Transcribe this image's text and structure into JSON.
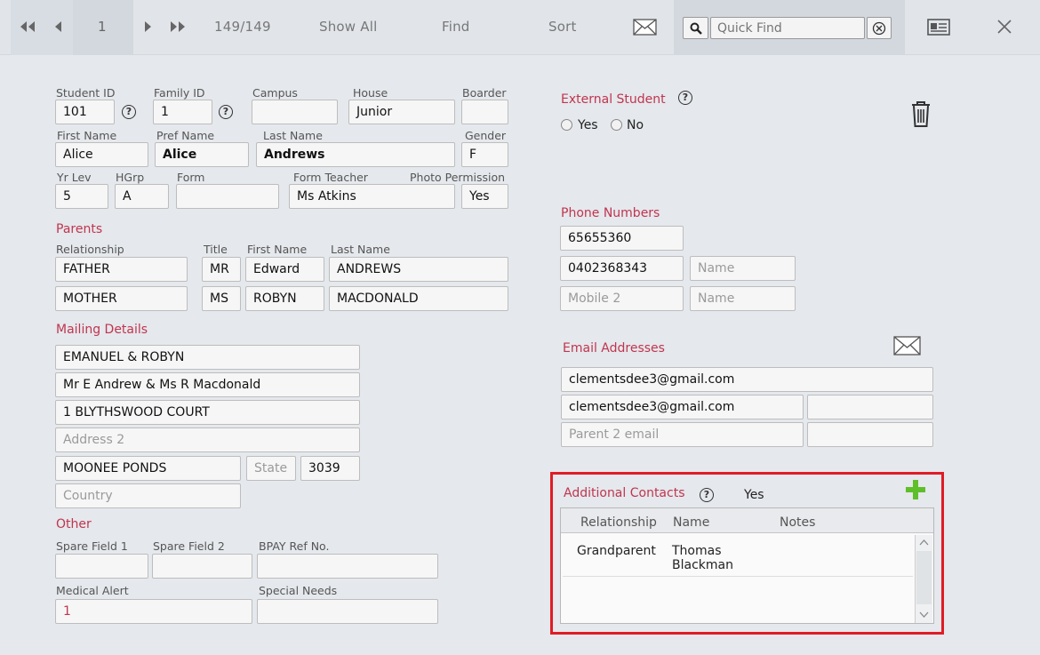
{
  "toolbar": {
    "record_current": "1",
    "record_count": "149/149",
    "show_all": "Show All",
    "find": "Find",
    "sort": "Sort",
    "quick_find_placeholder": "Quick Find"
  },
  "student": {
    "labels": {
      "student_id": "Student ID",
      "family_id": "Family ID",
      "campus": "Campus",
      "house": "House",
      "boarder": "Boarder",
      "first_name": "First Name",
      "pref_name": "Pref Name",
      "last_name": "Last Name",
      "gender": "Gender",
      "yr_lev": "Yr Lev",
      "hgrp": "HGrp",
      "form": "Form",
      "form_teacher": "Form Teacher",
      "photo_permission": "Photo Permission"
    },
    "student_id": "101",
    "family_id": "1",
    "campus": "",
    "house": "Junior",
    "boarder": "",
    "first_name": "Alice",
    "pref_name": "Alice",
    "last_name": "Andrews",
    "gender": "F",
    "yr_lev": "5",
    "hgrp": "A",
    "form": "",
    "form_teacher": "Ms Atkins",
    "photo_permission": "Yes"
  },
  "parents": {
    "title": "Parents",
    "headers": {
      "relationship": "Relationship",
      "title": "Title",
      "first_name": "First Name",
      "last_name": "Last Name"
    },
    "rows": [
      {
        "relationship": "FATHER",
        "title": "MR",
        "first_name": "Edward",
        "last_name": "ANDREWS"
      },
      {
        "relationship": "MOTHER",
        "title": "MS",
        "first_name": "ROBYN",
        "last_name": "MACDONALD"
      }
    ]
  },
  "mailing": {
    "title": "Mailing Details",
    "line1": "EMANUEL & ROBYN",
    "line2": "Mr E Andrew & Ms R Macdonald",
    "line3": "1 BLYTHSWOOD COURT",
    "address2_placeholder": "Address 2",
    "suburb": "MOONEE PONDS",
    "state_placeholder": "State",
    "postcode": "3039",
    "country_placeholder": "Country"
  },
  "other": {
    "title": "Other",
    "spare1_label": "Spare Field 1",
    "spare2_label": "Spare Field 2",
    "bpay_label": "BPAY Ref No.",
    "medical_label": "Medical Alert",
    "special_label": "Special Needs",
    "medical_value": "1"
  },
  "external": {
    "title": "External Student",
    "yes": "Yes",
    "no": "No"
  },
  "phones": {
    "title": "Phone Numbers",
    "phone1": "65655360",
    "phone2": "0402368343",
    "name_placeholder": "Name",
    "mobile2_placeholder": "Mobile 2"
  },
  "email": {
    "title": "Email Addresses",
    "email1": "clementsdee3@gmail.com",
    "email2": "clementsdee3@gmail.com",
    "parent2_placeholder": "Parent 2 email"
  },
  "contacts": {
    "title": "Additional Contacts",
    "flag": "Yes",
    "headers": {
      "relationship": "Relationship",
      "name": "Name",
      "notes": "Notes"
    },
    "rows": [
      {
        "relationship": "Grandparent",
        "name_line1": "Thomas",
        "name_line2": "Blackman",
        "notes": ""
      }
    ]
  },
  "colors": {
    "section": "#c0354f",
    "highlight": "#e01c25",
    "add": "#5fbf2a"
  },
  "icons": [
    "first-record-icon",
    "prev-record-icon",
    "next-record-icon",
    "last-record-icon",
    "envelope-icon",
    "search-icon",
    "clear-icon",
    "card-view-icon",
    "close-icon",
    "trash-icon",
    "help-icon",
    "add-icon"
  ]
}
